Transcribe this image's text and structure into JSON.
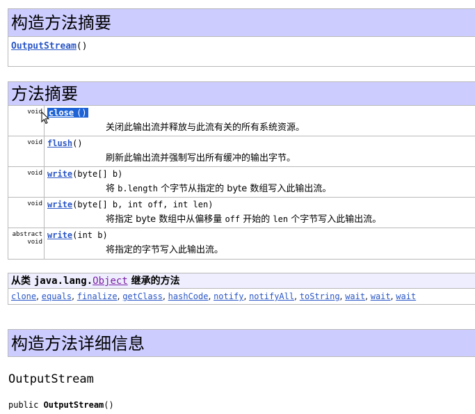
{
  "constructor_summary": {
    "title": "构造方法摘要",
    "items": [
      {
        "name": "OutputStream",
        "params": "()"
      }
    ]
  },
  "method_summary": {
    "title": "方法摘要",
    "rows": [
      {
        "type": "void",
        "name": "close",
        "params": "()",
        "desc_parts": [
          "关闭此输出流并释放与此流有关的所有系统资源。"
        ]
      },
      {
        "type": "void",
        "name": "flush",
        "params": "()",
        "desc_parts": [
          "刷新此输出流并强制写出所有缓冲的输出字节。"
        ]
      },
      {
        "type": "void",
        "name": "write",
        "params": "(byte[] b)",
        "desc_parts": [
          "将 ",
          "b.length",
          " 个字节从指定的 byte 数组写入此输出流。"
        ]
      },
      {
        "type": "void",
        "name": "write",
        "params": "(byte[] b, int off, int len)",
        "desc_parts": [
          "将指定 byte 数组中从偏移量 ",
          "off",
          " 开始的 ",
          "len",
          " 个字节写入此输出流。"
        ]
      },
      {
        "type": "abstract void",
        "type_line1": "abstract",
        "type_line2": "void",
        "name": "write",
        "params": "(int b)",
        "desc_parts": [
          "将指定的字节写入此输出流。"
        ]
      }
    ]
  },
  "inherited": {
    "prefix": "从类 ",
    "class_pkg": "java.lang.",
    "class_name": "Object",
    "suffix": " 继承的方法",
    "methods": [
      "clone",
      "equals",
      "finalize",
      "getClass",
      "hashCode",
      "notify",
      "notifyAll",
      "toString",
      "wait",
      "wait",
      "wait"
    ]
  },
  "constructor_detail": {
    "title": "构造方法详细信息",
    "name": "OutputStream",
    "signature_prefix": "public ",
    "signature_name": "OutputStream",
    "signature_params": "()"
  }
}
